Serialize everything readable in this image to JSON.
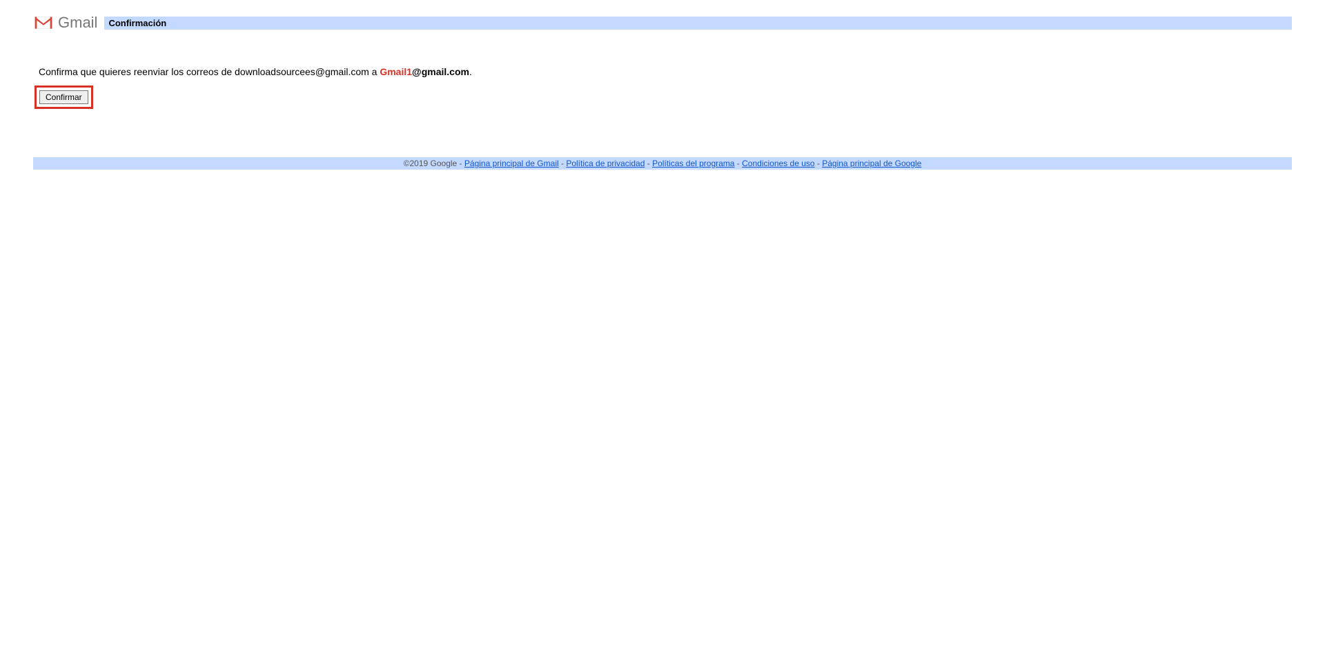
{
  "header": {
    "product_name": "Gmail",
    "title": "Confirmación"
  },
  "main": {
    "message_prefix": "Confirma que quieres reenviar los correos de downloadsourcees@gmail.com a  ",
    "target_prefix": "Gmail1",
    "target_suffix": "@gmail.com",
    "message_end": ".",
    "confirm_button": "Confirmar"
  },
  "footer": {
    "copyright": "©2019 Google",
    "separator": " - ",
    "links": [
      {
        "label": "Página principal de Gmail"
      },
      {
        "label": "Política de privacidad"
      },
      {
        "label": "Políticas del programa"
      },
      {
        "label": "Condiciones de uso"
      },
      {
        "label": "Página principal de Google"
      }
    ]
  }
}
